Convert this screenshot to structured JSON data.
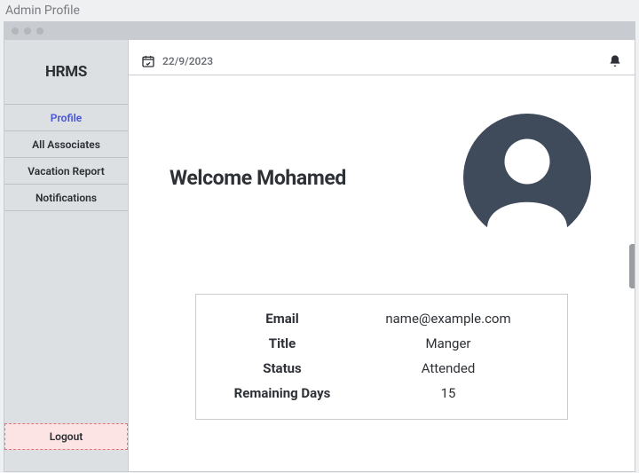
{
  "page_title": "Admin Profile",
  "brand": "HRMS",
  "sidebar": {
    "items": [
      {
        "label": "Profile",
        "active": true
      },
      {
        "label": "All Associates",
        "active": false
      },
      {
        "label": "Vacation Report",
        "active": false
      },
      {
        "label": "Notifications",
        "active": false
      }
    ],
    "logout_label": "Logout"
  },
  "topbar": {
    "date": "22/9/2023"
  },
  "hero": {
    "welcome": "Welcome Mohamed"
  },
  "info": {
    "rows": [
      {
        "label": "Email",
        "value": "name@example.com"
      },
      {
        "label": "Title",
        "value": "Manger"
      },
      {
        "label": "Status",
        "value": "Attended"
      },
      {
        "label": "Remaining Days",
        "value": "15"
      }
    ]
  },
  "colors": {
    "avatar_fill": "#3f4a5a"
  }
}
